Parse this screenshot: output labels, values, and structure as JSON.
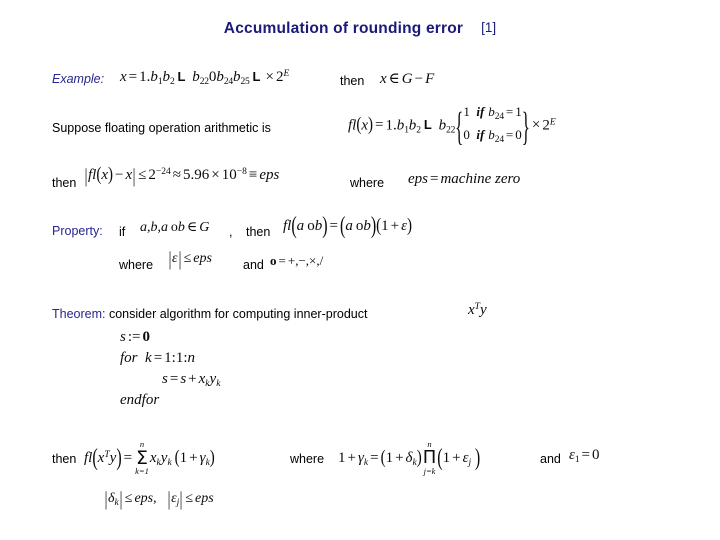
{
  "slide": {
    "title": "Accumulation of rounding error",
    "title_reference": "[1]",
    "title_color": "#1a1a7a",
    "background_color": "#ffffff",
    "body_text_color": "#000000",
    "label_color": "#26268c"
  },
  "example": {
    "label": "Example:",
    "formula": "x = 1.b₁b₂ … b₂₂ 0 b₂₄b₂₅ … × 2^E",
    "then_label": "then",
    "membership": "x ∈ G − F"
  },
  "suppose": {
    "text": "Suppose floating operation arithmetic is",
    "fl_lhs": "fl(x) = 1.b₁b₂ … b₂₂",
    "piecewise": [
      {
        "value": "1",
        "condition": "if b₂₄ = 1"
      },
      {
        "value": "0",
        "condition": "if b₂₄ = 0"
      }
    ],
    "fl_tail": "× 2^E"
  },
  "error_bound": {
    "then_label": "then",
    "inequality": "| fl(x) − x | ≤ 2⁻²⁴ ≈ 5.96×10⁻⁸ ≡ eps",
    "where_label": "where",
    "definition": "eps = machine zero"
  },
  "property": {
    "label": "Property:",
    "if_label": "if",
    "condition": "a, b, a∘b ∈ G",
    "comma": ",",
    "then_label": "then",
    "equation": "fl(a∘b) = (a∘b)(1+ε)",
    "where_label": "where",
    "epsilon_bound": "|ε| ≤ eps",
    "and_label": "and",
    "operator_def": "∘ = +, −, ×, /"
  },
  "theorem": {
    "label": "Theorem:",
    "text": "consider algorithm for computing inner-product",
    "inner_product": "xᵀy",
    "algorithm": [
      {
        "text": "s := 0",
        "indent": false
      },
      {
        "text": "for  k = 1:1:n",
        "indent": false
      },
      {
        "text": "s = s + x_k y_k",
        "indent": true
      },
      {
        "text": "endfor",
        "indent": false
      }
    ],
    "conclusion": {
      "then_label": "then",
      "sum_equation": "fl(xᵀy) = Σ(k=1..n) x_k y_k (1 + γ_k)",
      "where_label": "where",
      "gamma_equation": "1 + γ_k = (1 + δ_k) Π(j=k..n) (1 + ε_j)",
      "and_label": "and",
      "eps1": "ε₁ = 0",
      "bounds": "|δ_k| ≤ eps,   |ε_j| ≤ eps"
    }
  }
}
